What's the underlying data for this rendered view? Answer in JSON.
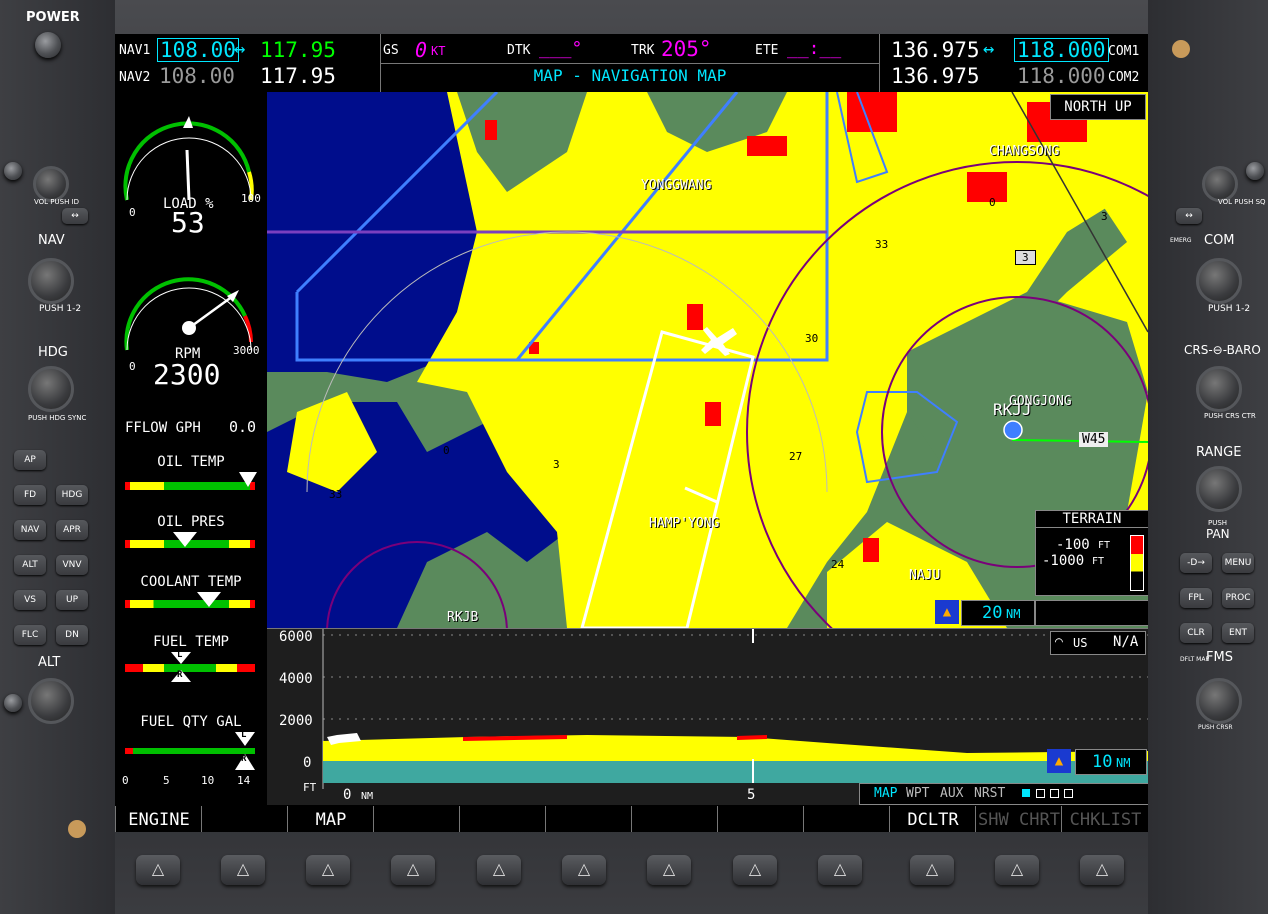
{
  "bezel": {
    "power_label": "POWER",
    "left": {
      "vol_label": "VOL PUSH ID",
      "nav_label": "NAV",
      "nav_push": "PUSH 1-2",
      "hdg_label": "HDG",
      "hdg_push": "PUSH HDG SYNC",
      "alt_label": "ALT",
      "buttons": [
        {
          "label": "AP"
        },
        {
          "label": "FD"
        },
        {
          "label": "HDG"
        },
        {
          "label": "NAV"
        },
        {
          "label": "APR"
        },
        {
          "label": "ALT"
        },
        {
          "label": "VNV"
        },
        {
          "label": "VS"
        },
        {
          "label": "UP"
        },
        {
          "label": "FLC"
        },
        {
          "label": "DN"
        }
      ]
    },
    "right": {
      "vol_label": "VOL PUSH SQ",
      "emerg_label": "EMERG",
      "com_label": "COM",
      "com_push": "PUSH 1-2",
      "crs_baro_label": "CRS-⊖-BARO",
      "crs_push": "PUSH CRS CTR",
      "range_label": "RANGE",
      "pan_push": "PUSH",
      "pan_label": "PAN",
      "buttons": [
        {
          "label": "-D→"
        },
        {
          "label": "MENU"
        },
        {
          "label": "FPL"
        },
        {
          "label": "PROC"
        },
        {
          "label": "CLR"
        },
        {
          "label": "ENT"
        }
      ],
      "dflt_map": "DFLT MAP",
      "fms_label": "FMS",
      "fms_push": "PUSH CRSR"
    },
    "softkey_glyph": "△"
  },
  "topbar": {
    "nav1_label": "NAV1",
    "nav1_active": "108.00",
    "nav1_arrow": "↔",
    "nav1_standby": "117.95",
    "nav2_label": "NAV2",
    "nav2_active": "108.00",
    "nav2_standby": "117.95",
    "gs_label": "GS",
    "gs_value": "0",
    "gs_unit": "KT",
    "dtk_label": "DTK",
    "dtk_value": "___°",
    "trk_label": "TRK",
    "trk_value": "205°",
    "ete_label": "ETE",
    "ete_value": "__:__",
    "page_title": "MAP - NAVIGATION MAP",
    "com1_standby": "136.975",
    "com_arrow": "↔",
    "com1_active": "118.000",
    "com1_label": "COM1",
    "com2_standby": "136.975",
    "com2_active": "118.000",
    "com2_label": "COM2"
  },
  "eis": {
    "load_label": "LOAD %",
    "load_value": "53",
    "load_min": "0",
    "load_max": "100",
    "load_fraction": 0.53,
    "rpm_label": "RPM",
    "rpm_value": "2300",
    "rpm_min": "0",
    "rpm_max": "3000",
    "rpm_fraction": 0.767,
    "fflow_label": "FFLOW GPH",
    "fflow_value": "0.0",
    "oil_temp_label": "OIL TEMP",
    "oil_pres_label": "OIL PRES",
    "coolant_label": "COOLANT TEMP",
    "fuel_temp_label": "FUEL TEMP",
    "fuel_qty_label": "FUEL QTY GAL",
    "fuel_scale": [
      "0",
      "5",
      "10",
      "14"
    ],
    "ind_L": "L",
    "ind_R": "R"
  },
  "map": {
    "orientation": "NORTH UP",
    "places": [
      "YONGGWANG",
      "CHANGSONG",
      "GONGJONG",
      "RKJJ",
      "HAMP'YONG",
      "NAJU",
      "RKJB"
    ],
    "airway": "W45",
    "route_box": "3",
    "numbers": [
      "0",
      "3",
      "33",
      "30",
      "27",
      "24",
      "33",
      "0",
      "3"
    ],
    "terrain_title": "TERRAIN",
    "terrain_legend": [
      {
        "value": "-100",
        "unit": "FT",
        "color": "#ff0000"
      },
      {
        "value": "-1000",
        "unit": "FT",
        "color": "#ffff00"
      }
    ],
    "range_value": "20",
    "range_unit": "NM",
    "colors": {
      "water": "#000d8c",
      "green": "#5a8a5c",
      "yellow": "#ffff00",
      "red": "#ff0000"
    }
  },
  "profile": {
    "alt_labels": [
      "6000",
      "4000",
      "2000",
      "0"
    ],
    "alt_unit": "FT",
    "dist_start": "0",
    "dist_unit": "NM",
    "dist_mid": "5",
    "obs_label": "US",
    "obs_value": "N/A",
    "range_value": "10",
    "range_unit": "NM",
    "page_groups": [
      "MAP",
      "WPT",
      "AUX",
      "NRST"
    ]
  },
  "softkeys": [
    "ENGINE",
    "",
    "MAP",
    "",
    "",
    "",
    "",
    "",
    "",
    "DCLTR",
    "SHW CHRT",
    "CHKLIST"
  ]
}
